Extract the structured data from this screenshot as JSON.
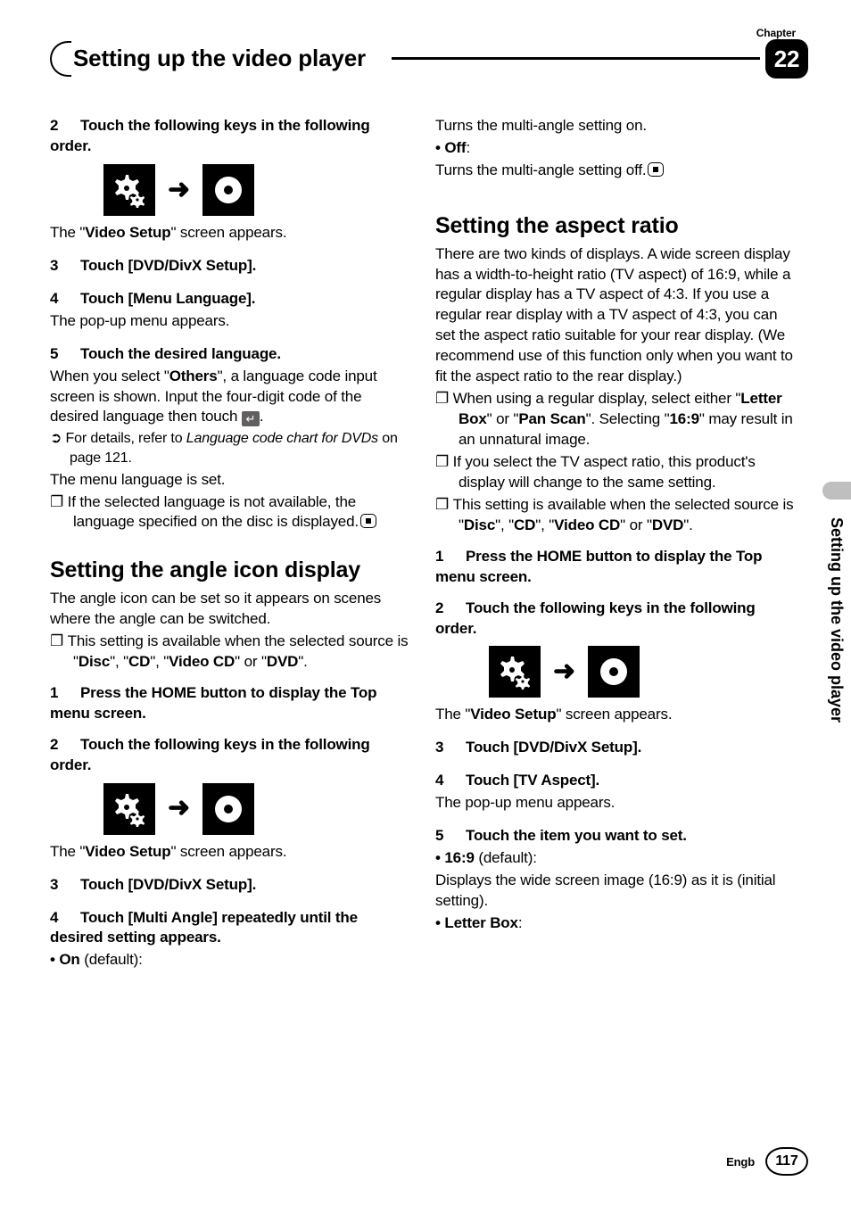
{
  "header": {
    "chapter_label": "Chapter",
    "title": "Setting up the video player",
    "chapter_num": "22"
  },
  "side_text": "Setting up the video player",
  "footer": {
    "lang": "Engb",
    "page": "117"
  },
  "col_left": {
    "s2": "Touch the following keys in the following order.",
    "video_setup_1": "The \"",
    "video_setup_bold": "Video Setup",
    "video_setup_2": "\" screen appears.",
    "s3": "Touch [DVD/DivX Setup].",
    "s4": "Touch [Menu Language].",
    "s4_sub": "The pop-up menu appears.",
    "s5": "Touch the desired language.",
    "s5_body_1": "When you select \"",
    "s5_body_b": "Others",
    "s5_body_2": "\", a language code input screen is shown. Input the four-digit code of the desired language then touch ",
    "s5_body_3": ".",
    "detail_ref_1": "For details, refer to ",
    "detail_ref_i": "Language code chart for DVDs",
    "detail_ref_2": " on page 121.",
    "menu_set": "The menu language is set.",
    "note_lang": "If the selected language is not available, the language specified on the disc is displayed.",
    "h_angle": "Setting the angle icon display",
    "angle_intro": "The angle icon can be set so it appears on scenes where the angle can be switched.",
    "angle_note_1": "This setting is available when the selected source is \"",
    "src_disc": "Disc",
    "q_cd": "\", \"",
    "src_cd": "CD",
    "src_vcd": "Video CD",
    "q_or": "\" or \"",
    "src_dvd": "DVD",
    "q_end": "\".",
    "a_s1": "Press the HOME button to display the Top menu screen.",
    "a_s2": "Touch the following keys in the following order.",
    "a_s3": "Touch [DVD/DivX Setup].",
    "a_s4": "Touch [Multi Angle] repeatedly until the desired setting appears.",
    "on_label": "On",
    "on_default": " (default):"
  },
  "col_right": {
    "on_body": "Turns the multi-angle setting on.",
    "off_label": "Off",
    "off_colon": ":",
    "off_body": "Turns the multi-angle setting off.",
    "h_aspect": "Setting the aspect ratio",
    "aspect_intro": "There are two kinds of displays. A wide screen display has a width-to-height ratio (TV aspect) of 16:9, while a regular display has a TV aspect of 4:3. If you use a regular rear display with a TV aspect of 4:3, you can set the aspect ratio suitable for your rear display. (We recommend use of this function only when you want to fit the aspect ratio to the rear display.)",
    "note1_a": "When using a regular display, select either \"",
    "lb": "Letter Box",
    "note1_b": "\" or \"",
    "ps": "Pan Scan",
    "note1_c": "\". Selecting \"",
    "r169": "16:9",
    "note1_d": "\" may result in an unnatural image.",
    "note2": "If you select the TV aspect ratio, this product's display will change to the same setting.",
    "note3_a": "This setting is available when the selected source is \"",
    "r_s1": "Press the HOME button to display the Top menu screen.",
    "r_s2": "Touch the following keys in the following order.",
    "r_s3": "Touch [DVD/DivX Setup].",
    "r_s4": "Touch [TV Aspect].",
    "r_s4_sub": "The pop-up menu appears.",
    "r_s5": "Touch the item you want to set.",
    "b169": "16:9",
    "b169_def": " (default):",
    "b169_body": "Displays the wide screen image (16:9) as it is (initial setting).",
    "blb": "Letter Box",
    "blb_colon": ":"
  }
}
